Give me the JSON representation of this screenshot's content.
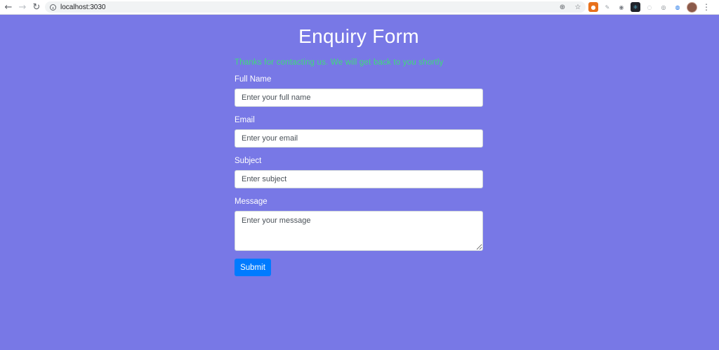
{
  "browser": {
    "url": "localhost:3030",
    "icons": {
      "back": "arrow-left-icon",
      "forward": "arrow-right-icon",
      "reload": "reload-icon",
      "site_info": "info-icon",
      "zoom": "zoom-icon",
      "bookmark": "star-icon",
      "menu": "kebab-menu-icon"
    },
    "extensions": [
      {
        "name": "extension-1-icon",
        "color": "#e8711c"
      },
      {
        "name": "extension-2-icon",
        "color": "#9aa0a6"
      },
      {
        "name": "extension-3-icon",
        "color": "#7b7f86"
      },
      {
        "name": "react-devtools-icon",
        "color": "#20232a"
      },
      {
        "name": "extension-5-icon",
        "color": "#c0c4c9"
      },
      {
        "name": "extension-6-icon",
        "color": "#80868b"
      },
      {
        "name": "extension-7-icon",
        "color": "#1a73e8"
      }
    ]
  },
  "form": {
    "title": "Enquiry Form",
    "success_message": "Thanks for contacting us. We will get back to you shortly",
    "fields": [
      {
        "label": "Full Name",
        "placeholder": "Enter your full name",
        "value": ""
      },
      {
        "label": "Email",
        "placeholder": "Enter your email",
        "value": ""
      },
      {
        "label": "Subject",
        "placeholder": "Enter subject",
        "value": ""
      },
      {
        "label": "Message",
        "placeholder": "Enter your message",
        "value": ""
      }
    ],
    "submit_label": "Submit"
  },
  "colors": {
    "background": "#7878e6",
    "success": "#3ddc7a",
    "primary_button": "#007bff"
  }
}
